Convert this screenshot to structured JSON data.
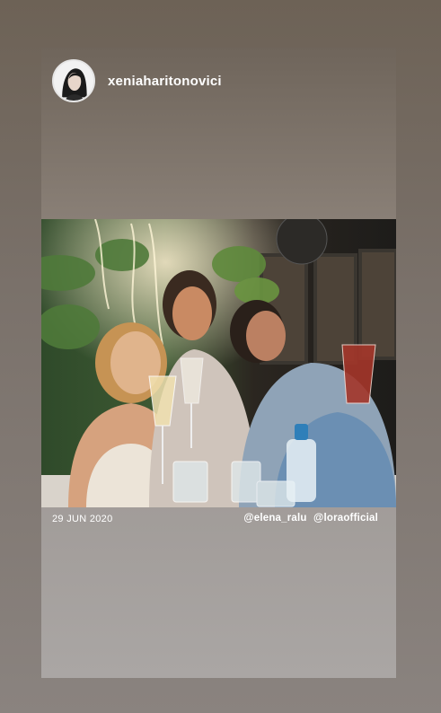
{
  "story": {
    "username": "xeniaharitonovici",
    "date": "29 JUN 2020",
    "mentions": [
      "@elena_ralu",
      "@loraofficial"
    ],
    "photo_alt": "three-women-toasting-drinks-photo"
  },
  "colors": {
    "background": "#6b6258",
    "text": "#ffffff"
  }
}
